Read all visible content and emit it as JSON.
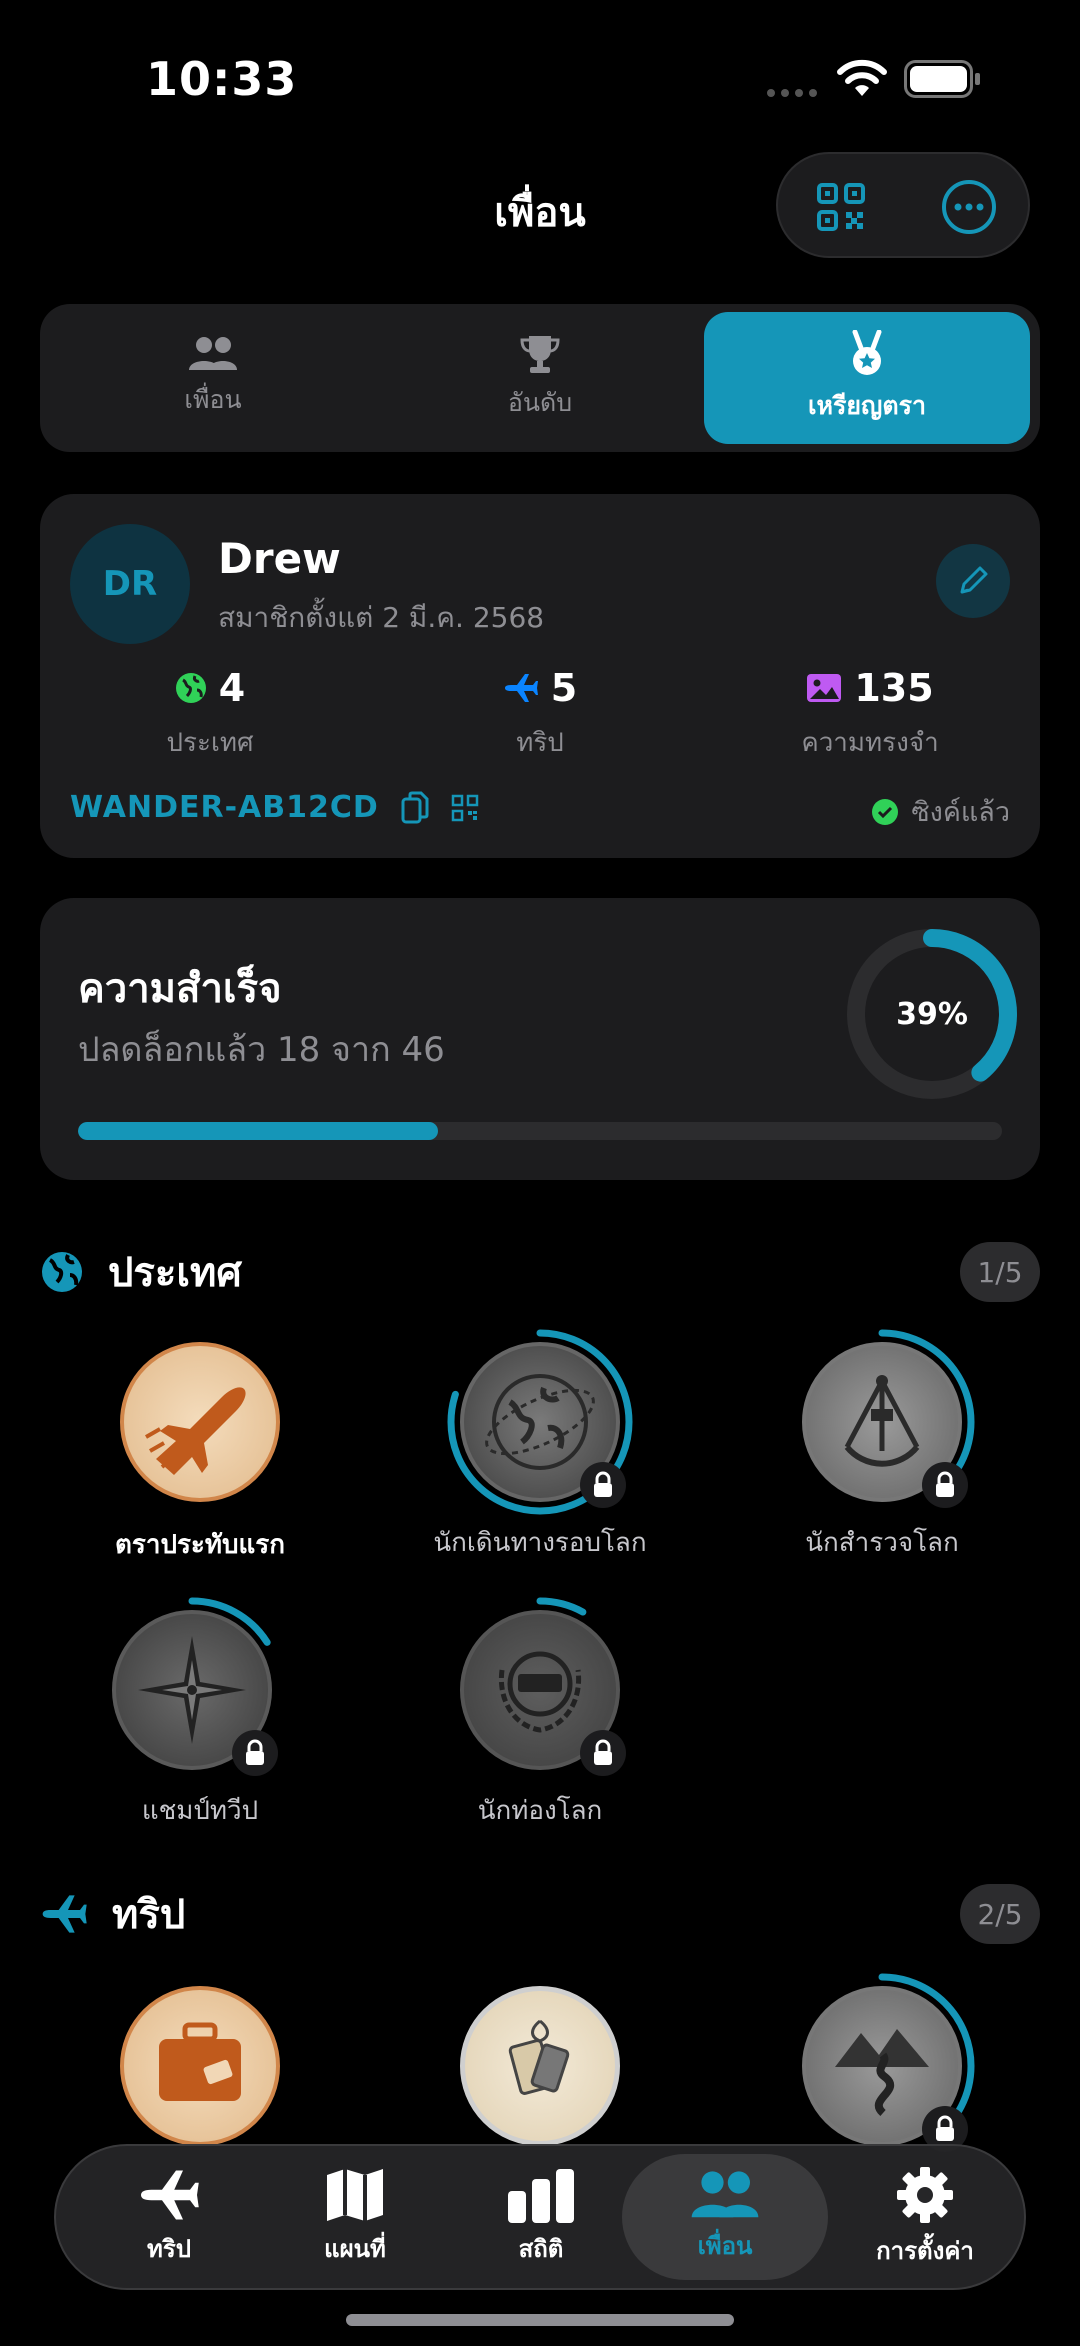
{
  "status": {
    "time": "10:33"
  },
  "header": {
    "title": "เพื่อน",
    "qr_icon": "qr-code-icon",
    "more_icon": "ellipsis-circle-icon"
  },
  "segments": [
    {
      "label": "เพื่อน",
      "icon": "people-icon",
      "active": false
    },
    {
      "label": "อันดับ",
      "icon": "trophy-icon",
      "active": false
    },
    {
      "label": "เหรียญตรา",
      "icon": "medal-icon",
      "active": true
    }
  ],
  "profile": {
    "initials": "DR",
    "name": "Drew",
    "member_since": "สมาชิกตั้งแต่ 2 มี.ค. 2568",
    "stats": [
      {
        "value": "4",
        "label": "ประเทศ",
        "icon": "globe-icon",
        "color": "#30d158"
      },
      {
        "value": "5",
        "label": "ทริป",
        "icon": "airplane-icon",
        "color": "#0a84ff"
      },
      {
        "value": "135",
        "label": "ความทรงจำ",
        "icon": "photo-icon",
        "color": "#bf5af2"
      }
    ],
    "code": "WANDER-AB12CD",
    "sync_status": "ซิงค์แล้ว"
  },
  "achievements": {
    "title": "ความสำเร็จ",
    "subtitle": "ปลดล็อกแล้ว 18 จาก 46",
    "percent_label": "39%",
    "progress": 0.39
  },
  "sections": [
    {
      "title": "ประเทศ",
      "count": "1/5",
      "badges": [
        {
          "label": "ตราประทับแรก",
          "unlocked": true,
          "progress": 1.0
        },
        {
          "label": "นักเดินทางรอบโลก",
          "unlocked": false,
          "progress": 0.8
        },
        {
          "label": "นักสำรวจโลก",
          "unlocked": false,
          "progress": 0.4
        },
        {
          "label": "แชมป์ทวีป",
          "unlocked": false,
          "progress": 0.16
        },
        {
          "label": "นักท่องโลก",
          "unlocked": false,
          "progress": 0.08
        }
      ]
    },
    {
      "title": "ทริป",
      "count": "2/5",
      "badges": [
        {
          "label": "",
          "unlocked": true,
          "progress": 1.0
        },
        {
          "label": "",
          "unlocked": true,
          "progress": 1.0
        },
        {
          "label": "",
          "unlocked": false,
          "progress": 0.4
        }
      ]
    }
  ],
  "tabbar": [
    {
      "label": "ทริป",
      "icon": "airplane-icon",
      "active": false
    },
    {
      "label": "แผนที่",
      "icon": "map-icon",
      "active": false
    },
    {
      "label": "สถิติ",
      "icon": "bar-chart-icon",
      "active": false
    },
    {
      "label": "เพื่อน",
      "icon": "people-icon",
      "active": true
    },
    {
      "label": "การตั้งค่า",
      "icon": "gear-icon",
      "active": false
    }
  ],
  "colors": {
    "accent": "#1596b8",
    "card": "#1c1c1e",
    "muted": "#8e8e93"
  }
}
